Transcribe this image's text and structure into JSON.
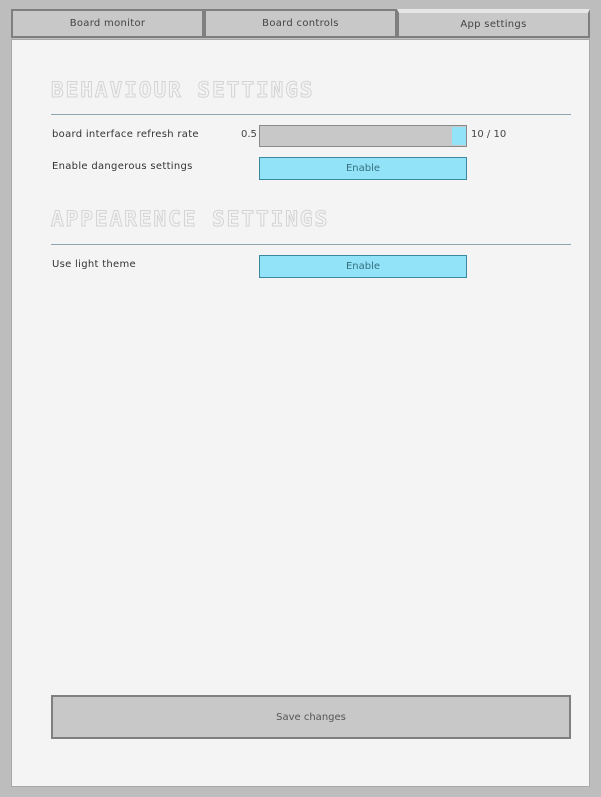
{
  "tabs": [
    {
      "label": "Board monitor"
    },
    {
      "label": "Board controls"
    },
    {
      "label": "App settings"
    }
  ],
  "active_tab": "App settings",
  "behaviour": {
    "title": "BEHAVIOUR SETTINGS",
    "refresh_rate": {
      "label": "board interface refresh rate",
      "min_label": "0.5",
      "value": 10,
      "max": 10,
      "readout": "10 / 10"
    },
    "dangerous": {
      "label": "Enable dangerous settings",
      "button_label": "Enable"
    }
  },
  "appearance": {
    "title": "APPEARENCE SETTINGS",
    "light_theme": {
      "label": "Use light theme",
      "button_label": "Enable"
    }
  },
  "save_label": "Save changes",
  "colors": {
    "accent": "#92e3f7",
    "panel_bg": "#f4f4f4",
    "control_bg": "#c8c8c8"
  }
}
